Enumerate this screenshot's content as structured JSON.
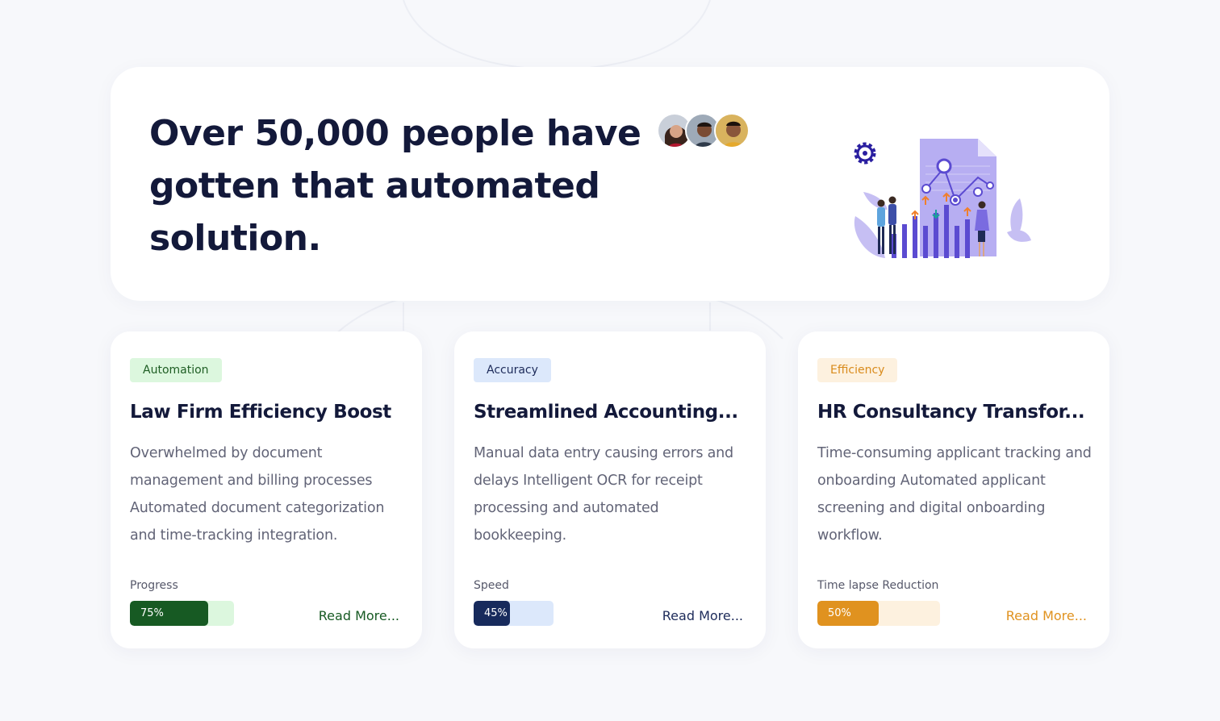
{
  "hero": {
    "title": "Over 50,000 people have gotten that automated solution."
  },
  "colors": {
    "background": "#f7f8fb",
    "heading": "#13193a",
    "body_text": "#626477",
    "illustration_accent": "#5b4bd1"
  },
  "cards": [
    {
      "tag": "Automation",
      "title": "Law Firm Efficiency Boost",
      "description": "Overwhelmed by document management and billing processes Automated document categorization and time-tracking integration.",
      "metric_label": "Progress",
      "metric_value": "75%",
      "metric_fraction": 0.75,
      "read_more": "Read More...",
      "colors": {
        "tag_bg": "#dcf7de",
        "tag_text": "#1f5e24",
        "bar": "#175a23",
        "track": "#dcf7de",
        "link": "#175a23"
      }
    },
    {
      "tag": "Accuracy",
      "title": "Streamlined Accounting...",
      "description": "Manual data entry causing errors and delays Intelligent OCR for receipt processing and automated bookkeeping.",
      "metric_label": "Speed",
      "metric_value": "45%",
      "metric_fraction": 0.45,
      "read_more": "Read More...",
      "colors": {
        "tag_bg": "#dce8fb",
        "tag_text": "#1d2b5a",
        "bar": "#172a5c",
        "track": "#dce8fb",
        "link": "#1d2b5a"
      }
    },
    {
      "tag": "Efficiency",
      "title": "HR Consultancy Transfor...",
      "description": "Time-consuming applicant tracking and onboarding Automated applicant screening and digital onboarding workflow.",
      "metric_label": "Time lapse Reduction",
      "metric_value": "50%",
      "metric_fraction": 0.5,
      "read_more": "Read More...",
      "colors": {
        "tag_bg": "#fdf1df",
        "tag_text": "#d98b1c",
        "bar": "#e0921f",
        "track": "#fdf1df",
        "link": "#e0921f"
      }
    }
  ]
}
